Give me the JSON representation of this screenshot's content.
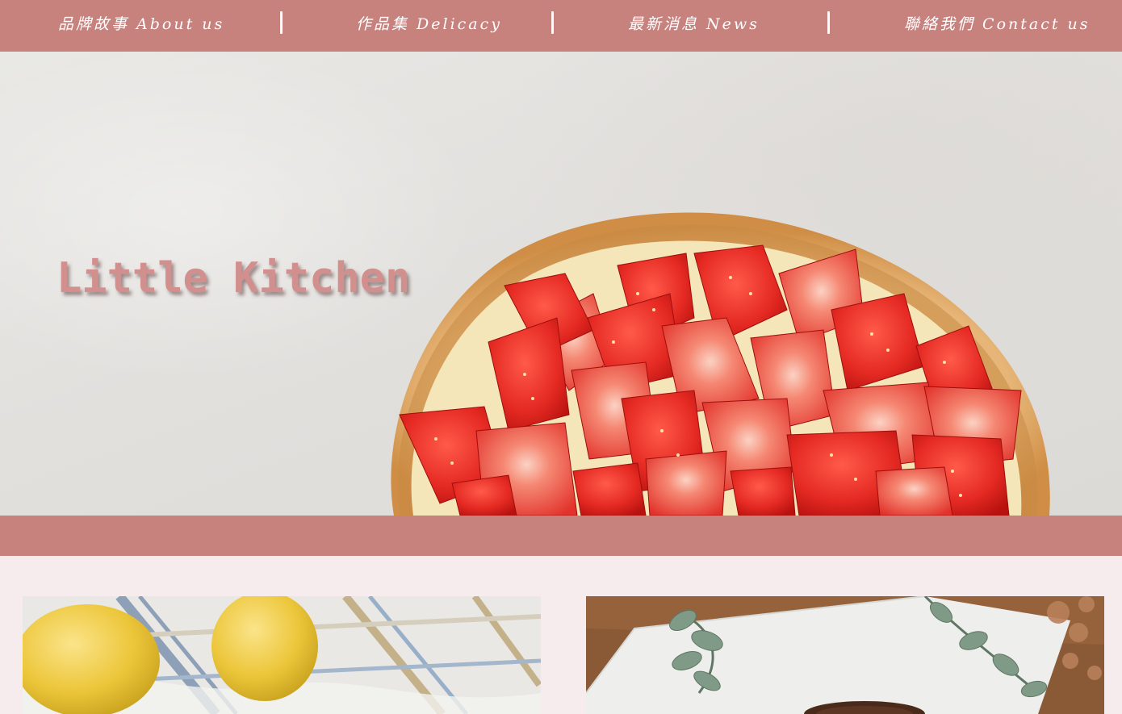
{
  "nav": {
    "items": [
      {
        "label": "品牌故事  About us"
      },
      {
        "label": "作品集  Delicacy"
      },
      {
        "label": "最新消息  News"
      },
      {
        "label": "聯絡我們  Contact us"
      }
    ]
  },
  "hero": {
    "title": "Little Kitchen",
    "image": "strawberry-tart-photo"
  },
  "gallery": {
    "cards": [
      {
        "image": "lemons-on-linen-photo"
      },
      {
        "image": "chocolate-cake-eucalyptus-photo"
      }
    ]
  },
  "colors": {
    "brand": "#c8827e",
    "page_background": "#f6eced",
    "title": "#d18f8e"
  }
}
